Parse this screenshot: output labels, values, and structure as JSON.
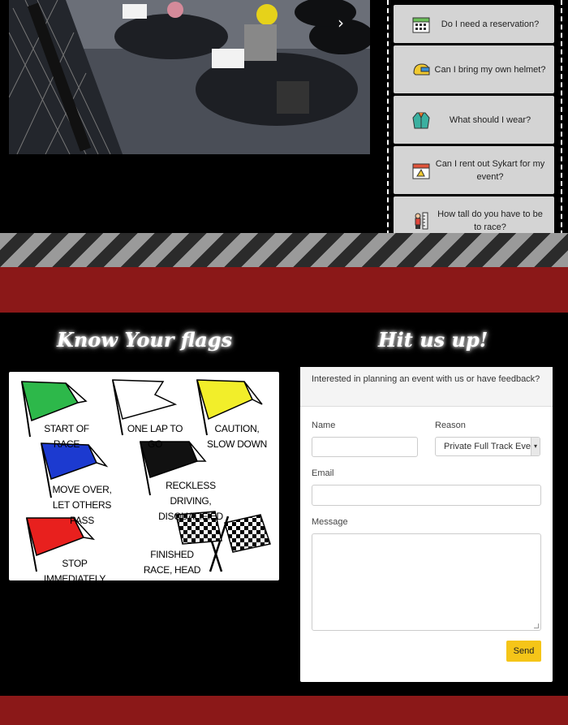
{
  "faq": {
    "items": [
      {
        "icon": "calendar-icon",
        "label": "Do I need a reservation?"
      },
      {
        "icon": "helmet-icon",
        "label": "Can I bring my own helmet?"
      },
      {
        "icon": "jacket-icon",
        "label": "What should I wear?"
      },
      {
        "icon": "event-calendar-icon",
        "label": "Can I rent out Sykart for my event?"
      },
      {
        "icon": "height-measure-icon",
        "label": "How tall do you have to be to race?"
      }
    ]
  },
  "flags": {
    "title": "Know Your flags",
    "items": [
      {
        "label": "START OF RACE",
        "color": "#2db84a"
      },
      {
        "label": "ONE LAP TO GO",
        "color": "#ffffff"
      },
      {
        "label": "CAUTION, SLOW DOWN",
        "color": "#f2ee2a"
      },
      {
        "label": "MOVE OVER, LET OTHERS PASS",
        "color": "#1c3ad0"
      },
      {
        "label": "RECKLESS DRIVING, DISQUALIFIED",
        "color": "#111111"
      },
      {
        "label": "STOP IMMEDIATELY",
        "color": "#e8201e"
      },
      {
        "label": "FINISHED RACE, HEAD TO THE PITS",
        "color": "checkered"
      }
    ]
  },
  "contact": {
    "title": "Hit us up!",
    "intro": "Interested in planning an event with us or have feedback?",
    "name_label": "Name",
    "reason_label": "Reason",
    "reason_value": "Private Full Track Eve",
    "email_label": "Email",
    "message_label": "Message",
    "send_label": "Send"
  },
  "colors": {
    "band_red": "#8b1818",
    "button_yellow": "#f5c518"
  }
}
